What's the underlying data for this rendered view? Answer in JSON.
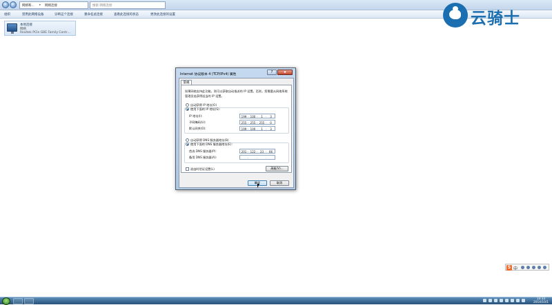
{
  "explorer": {
    "breadcrumb": [
      "网络和...",
      "网络连接"
    ],
    "search_placeholder": "搜索 网络连接",
    "commands": [
      "组织",
      "禁用此网络设备",
      "诊断这个连接",
      "重命名此连接",
      "查看此连接的状态",
      "更改此连接的设置"
    ],
    "connection": {
      "name": "本地连接",
      "status": "网络",
      "adapter": "Realtek PCIe GBE Family Contr..."
    }
  },
  "dialog": {
    "title": "Internet 协议版本 4 (TCP/IPv4) 属性",
    "help_label": "?",
    "close_label": "x",
    "tab": "常规",
    "description": "如果网络支持此功能，则可以获取自动指派的 IP 设置。否则，您需要从网络系统管理员处获得适当的 IP 设置。",
    "auto_ip": "自动获得 IP 地址(O)",
    "manual_ip": "使用下面的 IP 地址(S):",
    "ip_label": "IP 地址(I):",
    "ip": [
      "199",
      "100",
      "1",
      "3"
    ],
    "mask_label": "子网掩码(U):",
    "mask": [
      "255",
      "255",
      "255",
      "0"
    ],
    "gateway_label": "默认网关(D):",
    "gateway": [
      "199",
      "100",
      "1",
      "3"
    ],
    "auto_dns": "自动获得 DNS 服务器地址(B)",
    "manual_dns": "使用下面的 DNS 服务器地址(E):",
    "dns1_label": "首选 DNS 服务器(P):",
    "dns1": [
      "201",
      "122",
      "23",
      "66"
    ],
    "dns2_label": "备用 DNS 服务器(A):",
    "dns2": [
      "",
      "",
      "",
      ""
    ],
    "validate": "退出时验证设置(L)",
    "advanced": "高级(V)...",
    "ok": "确定",
    "cancel": "取消",
    "selected_ip_mode": "manual",
    "selected_dns_mode": "manual"
  },
  "watermark": {
    "text": "云骑士"
  },
  "ime": {
    "logo": "S",
    "mode": "中"
  },
  "taskbar": {
    "time": "14:33",
    "date": "2014/10/1"
  },
  "colors": {
    "accent": "#1b6fb0",
    "window_frame": "#aec9e6",
    "taskbar": "#24507a"
  }
}
